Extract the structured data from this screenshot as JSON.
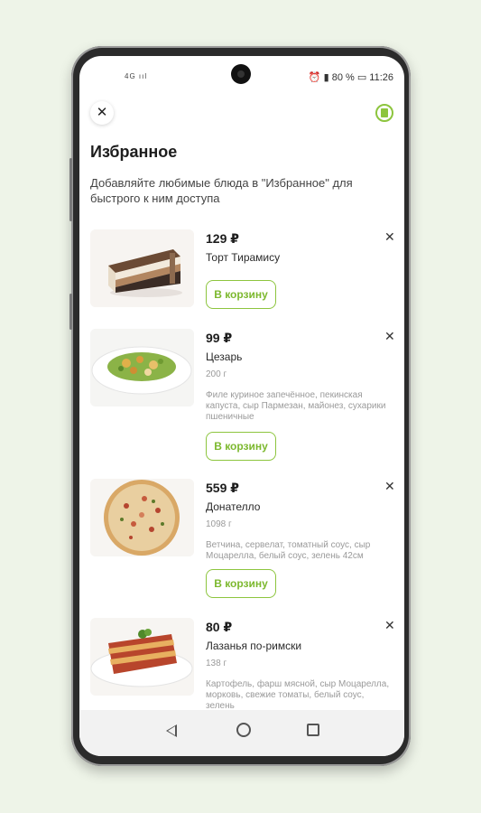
{
  "status": {
    "left": "4G ııl",
    "right": "⏰ ▮ 80 % ▭ 11:26",
    "time": "11:26",
    "battery": "80 %"
  },
  "header": {
    "close": "✕",
    "title": "Избранное",
    "subtitle": "Добавляйте любимые блюда в \"Избранное\" для быстрого к ним доступа"
  },
  "items": [
    {
      "price": "129 ₽",
      "name": "Торт Тирамису",
      "weight": "",
      "description": "",
      "button": "В корзину",
      "remove": "✕",
      "image": "tiramisu-cake"
    },
    {
      "price": "99 ₽",
      "name": "Цезарь",
      "weight": "200 г",
      "description": "Филе куриное запечённое, пекинская капуста, сыр Пармезан, майонез, сухарики пшеничные",
      "button": "В корзину",
      "remove": "✕",
      "image": "caesar-salad"
    },
    {
      "price": "559 ₽",
      "name": "Донателло",
      "weight": "1098 г",
      "description": "Ветчина, сервелат, томатный соус, сыр Моцарелла, белый соус, зелень 42см",
      "button": "В корзину",
      "remove": "✕",
      "image": "pizza"
    },
    {
      "price": "80 ₽",
      "name": "Лазанья по-римски",
      "weight": "138 г",
      "description": "Картофель, фарш мясной, сыр Моцарелла, морковь, свежие томаты, белый соус, зелень",
      "button": "",
      "remove": "✕",
      "image": "lasagna"
    }
  ],
  "colors": {
    "accent": "#8dc53e",
    "background": "#eef4e8",
    "text": "#1d1d1d",
    "muted": "#9a9a9a"
  }
}
